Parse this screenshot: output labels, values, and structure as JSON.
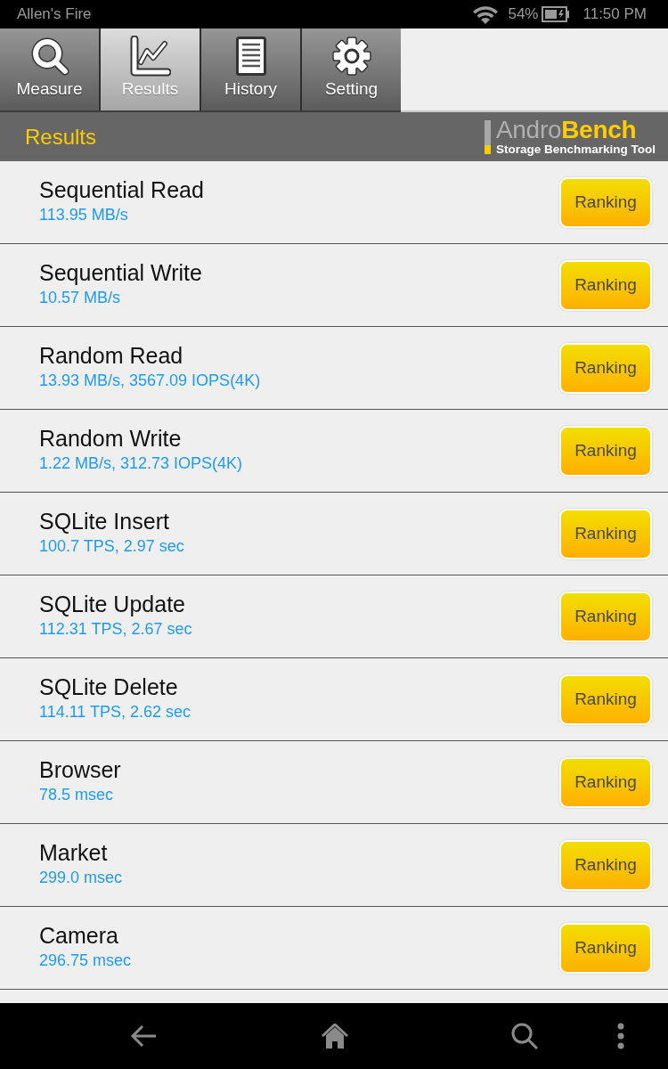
{
  "status_bar": {
    "device_name": "Allen's Fire",
    "battery": "54%",
    "time": "11:50 PM"
  },
  "tabs": [
    {
      "kind": "measure",
      "label": "Measure",
      "selected": false
    },
    {
      "kind": "results",
      "label": "Results",
      "selected": true
    },
    {
      "kind": "history",
      "label": "History",
      "selected": false
    },
    {
      "kind": "setting",
      "label": "Setting",
      "selected": false
    }
  ],
  "header": {
    "title": "Results",
    "logo": {
      "name": "Andro**Bench**",
      "tagline": "Storage Benchmarking Tool"
    }
  },
  "results": [
    {
      "name": "Sequential Read",
      "value": "113.95 MB/s",
      "button": "Ranking"
    },
    {
      "name": "Sequential Write",
      "value": "10.57 MB/s",
      "button": "Ranking"
    },
    {
      "name": "Random Read",
      "value": "13.93 MB/s, 3567.09 IOPS(4K)",
      "button": "Ranking"
    },
    {
      "name": "Random Write",
      "value": "1.22 MB/s, 312.73 IOPS(4K)",
      "button": "Ranking"
    },
    {
      "name": "SQLite Insert",
      "value": "100.7 TPS, 2.97 sec",
      "button": "Ranking"
    },
    {
      "name": "SQLite Update",
      "value": "112.31 TPS, 2.67 sec",
      "button": "Ranking"
    },
    {
      "name": "SQLite Delete",
      "value": "114.11 TPS, 2.62 sec",
      "button": "Ranking"
    },
    {
      "name": "Browser",
      "value": "78.5 msec",
      "button": "Ranking"
    },
    {
      "name": "Market",
      "value": "299.0 msec",
      "button": "Ranking"
    },
    {
      "name": "Camera",
      "value": "296.75 msec",
      "button": "Ranking"
    }
  ]
}
